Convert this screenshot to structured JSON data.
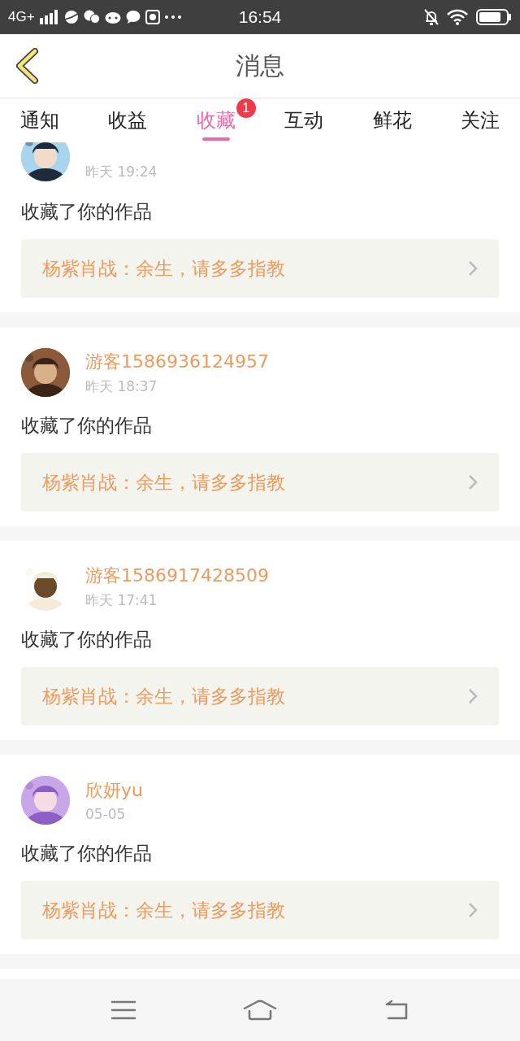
{
  "status_bar": {
    "network": "4G+",
    "time": "16:54"
  },
  "header": {
    "title": "消息"
  },
  "tabs": [
    {
      "label": "通知",
      "selected": false
    },
    {
      "label": "收益",
      "selected": false
    },
    {
      "label": "收藏",
      "selected": true,
      "badge": "1"
    },
    {
      "label": "互动",
      "selected": false
    },
    {
      "label": "鲜花",
      "selected": false
    },
    {
      "label": "关注",
      "selected": false
    }
  ],
  "messages": [
    {
      "cut_off": true,
      "time": "昨天 19:24",
      "action": "收藏了你的作品",
      "work": "杨紫肖战：余生，请多多指教"
    },
    {
      "cut_off": false,
      "name": "游客1586936124957",
      "time": "昨天 18:37",
      "action": "收藏了你的作品",
      "work": "杨紫肖战：余生，请多多指教"
    },
    {
      "cut_off": false,
      "name": "游客1586917428509",
      "time": "昨天 17:41",
      "action": "收藏了你的作品",
      "work": "杨紫肖战：余生，请多多指教"
    },
    {
      "cut_off": false,
      "name": "欣妍yu",
      "time": "05-05",
      "action": "收藏了你的作品",
      "work": "杨紫肖战：余生，请多多指教"
    }
  ]
}
